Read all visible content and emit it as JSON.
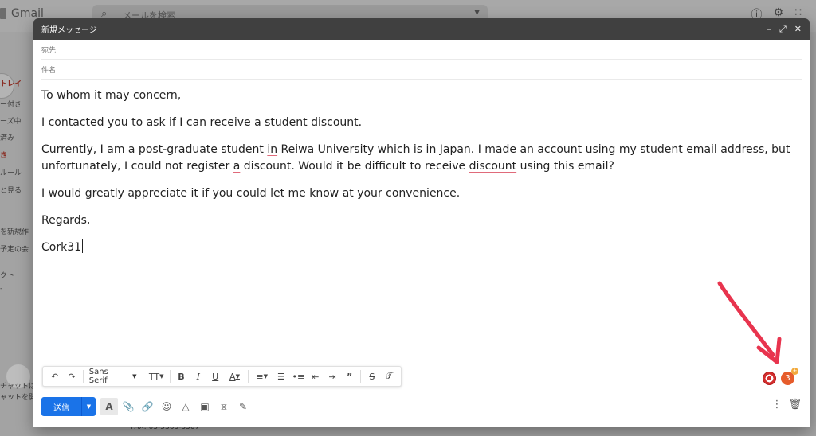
{
  "gmail": {
    "logo_text": "Gmail",
    "search_placeholder": "メールを検索",
    "sidebar": [
      "トレイ",
      "ー付き",
      "ーズ中",
      "済み",
      "き",
      "ルール",
      "と見る",
      "を新規作",
      "予定の会",
      "クト",
      "-"
    ],
    "sidebar_bottom": [
      "チャットは",
      "ャットを開"
    ],
    "footer_text": "FAX: 03-5363-3507"
  },
  "compose": {
    "title": "新規メッセージ",
    "to_label": "宛先",
    "subject_label": "件名",
    "body": {
      "greeting": "To whom it may concern,",
      "line1": "I contacted you to ask if I can receive a student discount.",
      "line2_a": "Currently, I am a post-graduate student ",
      "line2_in": "in",
      "line2_b": " Reiwa University which is in Japan. I made an account using my student email address, but unfortunately, I could not register ",
      "line2_aa": "a",
      "line2_c": " discount. Would it be difficult to receive ",
      "line2_disc": "discount",
      "line2_d": " using this email?",
      "line3": "I would greatly appreciate it if you could let me know at your convenience.",
      "closing": "Regards,",
      "signature": "Cork31"
    },
    "toolbar": {
      "font_name": "Sans Serif"
    },
    "send_label": "送信",
    "ext_badge": "3",
    "ext_plus": "+"
  },
  "colors": {
    "send_blue": "#1a73e8",
    "title_bg": "#404040",
    "annotation_red": "#e8344e"
  }
}
